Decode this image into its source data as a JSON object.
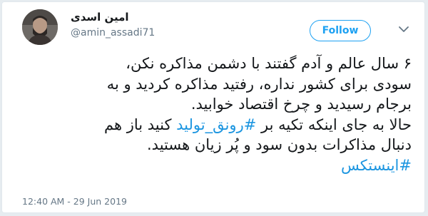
{
  "user": {
    "display_name": "امین اسدی",
    "handle": "@amin_assadi71"
  },
  "follow_button": {
    "label": "Follow"
  },
  "menu_icon": "chevron-down-icon",
  "tweet": {
    "line1": "۶ سال عالم و آدم گفتند با دشمن مذاکره نکن،",
    "line2": "سودی برای کشور نداره، رفتید مذاکره کردید و به",
    "line3": "برجام رسیدید و چرخ اقتصاد خوابید.",
    "line4_before": "حالا به جای اینکه تکیه بر ",
    "hashtag1": "#رونق_تولید",
    "line4_after": " کنید باز هم",
    "line5": "دنبال مذاکرات بدون سود و پُر زیان هستید.",
    "hashtag2": "#اینستکس"
  },
  "timestamp": "12:40 AM - 29 Jun 2019",
  "colors": {
    "accent": "#1da1f2",
    "hashtag": "#1b95e0",
    "text": "#14171a",
    "muted": "#657786"
  }
}
